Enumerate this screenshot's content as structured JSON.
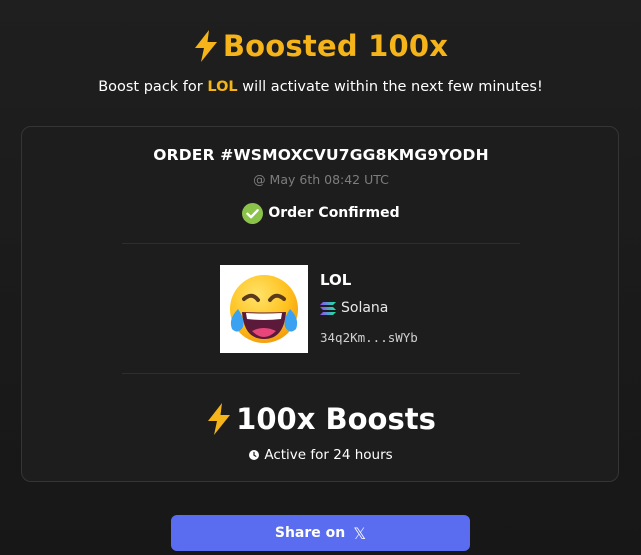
{
  "header": {
    "title": "Boosted 100x",
    "subtitle_prefix": "Boost pack for ",
    "subtitle_token": "LOL",
    "subtitle_suffix": " will activate within the next few minutes!",
    "accent_color": "#f4b41a"
  },
  "order": {
    "id_label": "ORDER #WSMOXCVU7GG8KMG9YODH",
    "timestamp": "@ May 6th 08:42 UTC",
    "status": "Order Confirmed",
    "status_color": "#8bc34a"
  },
  "token": {
    "name": "LOL",
    "chain": "Solana",
    "address": "34q2Km...sWYb",
    "image_icon": "laughing-tears-emoji"
  },
  "boost": {
    "amount_label": "100x Boosts",
    "duration": "Active for 24 hours"
  },
  "share": {
    "label": "Share on",
    "platform_glyph": "𝕏",
    "button_color": "#5a6cf0"
  }
}
